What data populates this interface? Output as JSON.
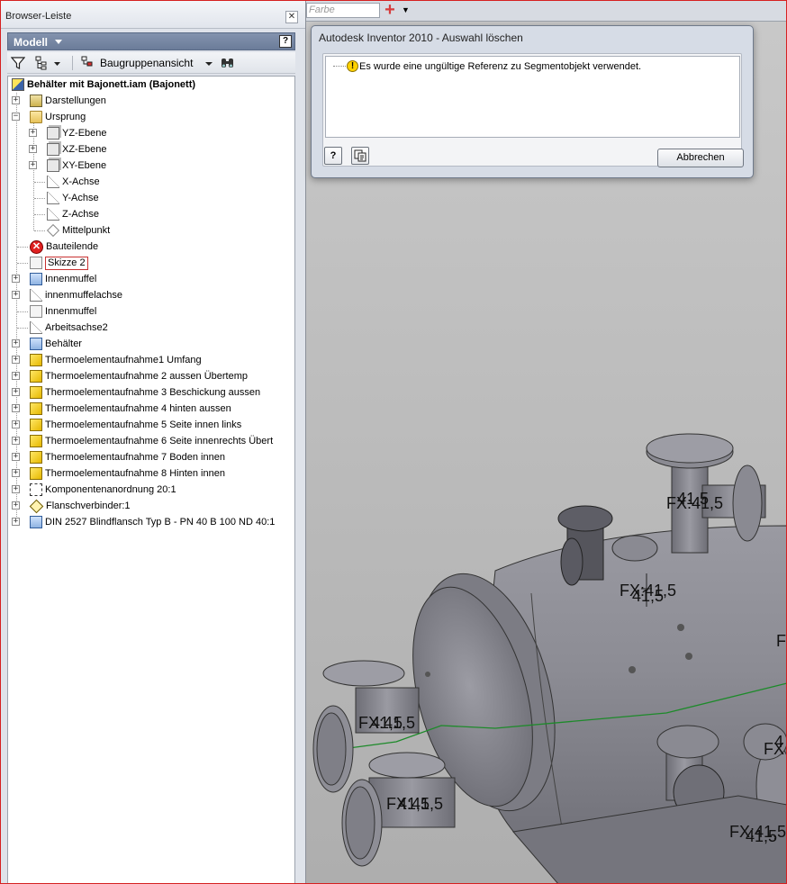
{
  "browser": {
    "title": "Browser-Leiste",
    "close_glyph": "✕",
    "model_label": "Modell",
    "help_glyph": "?",
    "toolbar": {
      "filter_icon": "filter-icon",
      "view_label": "Baugruppenansicht",
      "find_icon": "binoculars-icon"
    },
    "tree": {
      "root": "Behälter mit Bajonett.iam (Bajonett)",
      "items": [
        {
          "label": "Darstellungen",
          "icon": "representations-icon"
        },
        {
          "label": "Ursprung",
          "icon": "folder-icon"
        },
        {
          "label": "YZ-Ebene",
          "icon": "plane-icon"
        },
        {
          "label": "XZ-Ebene",
          "icon": "plane-icon"
        },
        {
          "label": "XY-Ebene",
          "icon": "plane-icon"
        },
        {
          "label": "X-Achse",
          "icon": "axis-icon"
        },
        {
          "label": "Y-Achse",
          "icon": "axis-icon"
        },
        {
          "label": "Z-Achse",
          "icon": "axis-icon"
        },
        {
          "label": "Mittelpunkt",
          "icon": "point-icon"
        },
        {
          "label": "Bauteilende",
          "icon": "end-of-part-icon"
        },
        {
          "label": "Skizze 2",
          "icon": "sketch-icon"
        },
        {
          "label": "Innenmuffel",
          "icon": "part-icon"
        },
        {
          "label": "innenmuffelachse",
          "icon": "work-axis-icon"
        },
        {
          "label": "Innenmuffel",
          "icon": "sketch-icon"
        },
        {
          "label": "Arbeitsachse2",
          "icon": "axis-icon"
        },
        {
          "label": "Behälter",
          "icon": "part-icon"
        },
        {
          "label": "Thermoelementaufnahme1 Umfang",
          "icon": "subassembly-icon"
        },
        {
          "label": "Thermoelementaufnahme 2  aussen Übertemp",
          "icon": "subassembly-icon"
        },
        {
          "label": "Thermoelementaufnahme 3  Beschickung aussen",
          "icon": "subassembly-icon"
        },
        {
          "label": "Thermoelementaufnahme 4 hinten aussen",
          "icon": "subassembly-icon"
        },
        {
          "label": "Thermoelementaufnahme 5 Seite innen links",
          "icon": "subassembly-icon"
        },
        {
          "label": "Thermoelementaufnahme 6  Seite innenrechts Übert",
          "icon": "subassembly-icon"
        },
        {
          "label": "Thermoelementaufnahme 7  Boden innen",
          "icon": "subassembly-icon"
        },
        {
          "label": "Thermoelementaufnahme 8 Hinten innen",
          "icon": "subassembly-icon"
        },
        {
          "label": "Komponentenanordnung 20:1",
          "icon": "pattern-icon"
        },
        {
          "label": "Flanschverbinder:1",
          "icon": "flange-connector-icon"
        },
        {
          "label": "DIN 2527 Blindflansch Typ B - PN 40 B 100 ND 40:1",
          "icon": "content-center-part-icon"
        }
      ]
    }
  },
  "topstrip": {
    "color_field": "Farbe",
    "color_dropdown_icon": "chevron-down-icon",
    "add_icon": "plus-icon"
  },
  "dialog": {
    "title": "Autodesk Inventor 2010 - Auswahl löschen",
    "message": "Es wurde eine ungültige Referenz zu Segmentobjekt verwendet.",
    "warn_glyph": "!",
    "help_glyph": "?",
    "cancel_label": "Abbrechen"
  },
  "viewport": {
    "dimensions": [
      {
        "text": "FX:41,5"
      },
      {
        "text": "41,5"
      },
      {
        "text": "FX:41,5"
      },
      {
        "text": "41,5"
      },
      {
        "text": "FX:41,5"
      },
      {
        "text": "41,5"
      },
      {
        "text": "FX:41,5"
      },
      {
        "text": "41,5"
      },
      {
        "text": "FX:41,5"
      },
      {
        "text": "41,5"
      },
      {
        "text": "F"
      },
      {
        "text": "FX"
      },
      {
        "text": "4"
      }
    ]
  }
}
